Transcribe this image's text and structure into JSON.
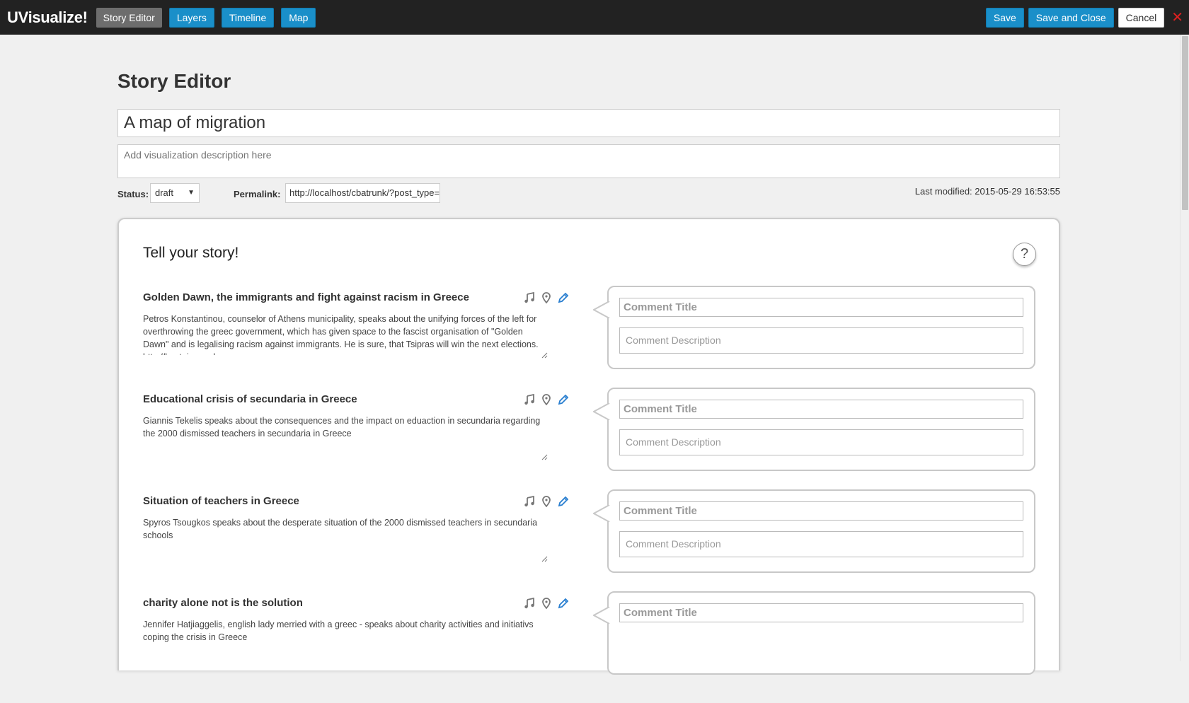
{
  "app": {
    "brand": "UVisualize!",
    "nav": [
      "Story Editor",
      "Layers",
      "Timeline",
      "Map"
    ],
    "actions": {
      "save": "Save",
      "save_close": "Save and Close",
      "cancel": "Cancel",
      "close": "✕"
    }
  },
  "editor": {
    "title": "Story Editor",
    "viz_title": "A map of migration",
    "desc_placeholder": "Add visualization description here",
    "status_label": "Status:",
    "status_value": "draft",
    "permalink_label": "Permalink:",
    "permalink_value": "http://localhost/cbatrunk/?post_type=",
    "last_modified": "Last modified: 2015-05-29 16:53:55"
  },
  "story": {
    "heading": "Tell your story!",
    "help": "?",
    "comment_title_placeholder": "Comment Title",
    "comment_desc_placeholder": "Comment Description",
    "items": [
      {
        "title": "Golden Dawn, the immigrants and fight against racism in Greece",
        "desc": "Petros Konstantinou, counselor of Athens municipality, speaks about the unifying forces of the left for overthrowing the greec government, which has given space to the fascist organisation of \"Golden Dawn\" and is legalising racism against immigrants. He is sure, that Tsipras will win the next elections. http://bostnia.wordpress.com"
      },
      {
        "title": "Educational crisis of secundaria in Greece",
        "desc": "Giannis Tekelis speaks about the consequences and the impact on eduaction in secundaria regarding the 2000 dismissed teachers in secundaria in Greece"
      },
      {
        "title": "Situation of teachers in Greece",
        "desc": "Spyros Tsougkos speaks about the desperate situation of the 2000 dismissed teachers in secundaria schools"
      },
      {
        "title": "charity alone not is the solution",
        "desc": "Jennifer Hatjiaggelis, english lady merried with a greec - speaks about charity activities and initiativs coping the crisis in Greece"
      }
    ]
  },
  "colors": {
    "topbar": "#222222",
    "accent": "#1a8fc9",
    "active": "#6d6d6d",
    "close": "#e02020",
    "edit_icon": "#2a7fd0"
  },
  "icons": [
    "music-icon",
    "map-pin-icon",
    "pencil-icon",
    "help-icon",
    "close-icon"
  ]
}
